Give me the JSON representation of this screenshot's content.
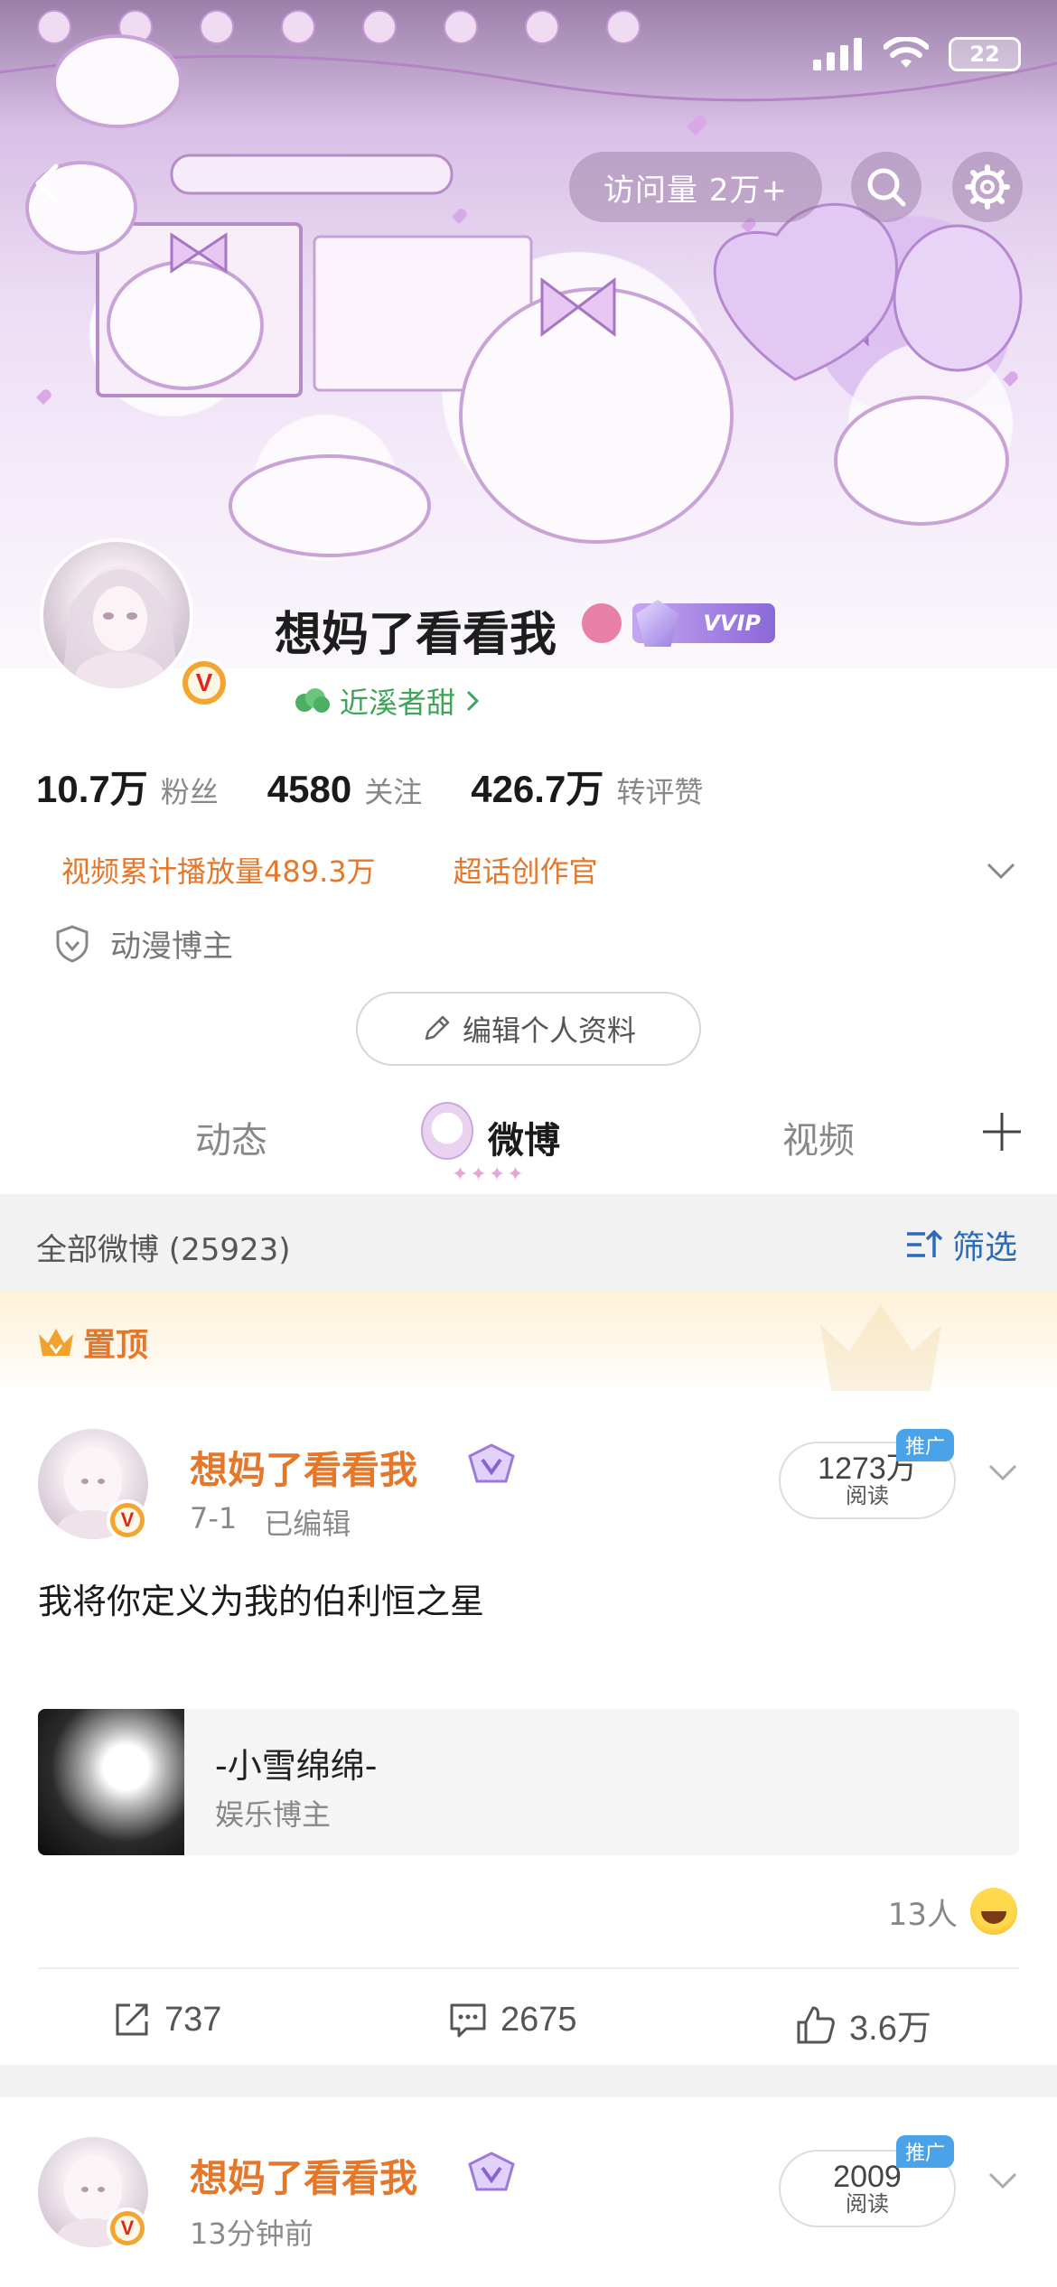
{
  "status_bar": {
    "battery": "22"
  },
  "header": {
    "visits": "访问量 2万+"
  },
  "profile": {
    "name": "想妈了看看我",
    "vip": "VVIP",
    "group": "近溪者甜",
    "stats": [
      {
        "num": "10.7万",
        "label": "粉丝"
      },
      {
        "num": "4580",
        "label": "关注"
      },
      {
        "num": "426.7万",
        "label": "转评赞"
      }
    ],
    "highlights": [
      "视频累计播放量489.3万",
      "超话创作官"
    ],
    "tag": "动漫博主",
    "edit_label": "编辑个人资料"
  },
  "tabs": {
    "t1": "动态",
    "t2": "微博",
    "t3": "视频"
  },
  "filter": {
    "title": "全部微博 (25923)",
    "button": "筛选"
  },
  "pinned": {
    "label": "置顶"
  },
  "posts": [
    {
      "name": "想妈了看看我",
      "date": "7-1",
      "edited": "已编辑",
      "reads": "1273万",
      "reads_label": "阅读",
      "promo": "推广",
      "text": "我将你定义为我的伯利恒之星",
      "card_title": "-小雪绵绵-",
      "card_sub": "娱乐博主",
      "reactors": "13人",
      "reposts": "737",
      "comments": "2675",
      "likes": "3.6万"
    },
    {
      "name": "想妈了看看我",
      "time": "13分钟前",
      "reads": "2009",
      "reads_label": "阅读",
      "promo": "推广"
    }
  ]
}
